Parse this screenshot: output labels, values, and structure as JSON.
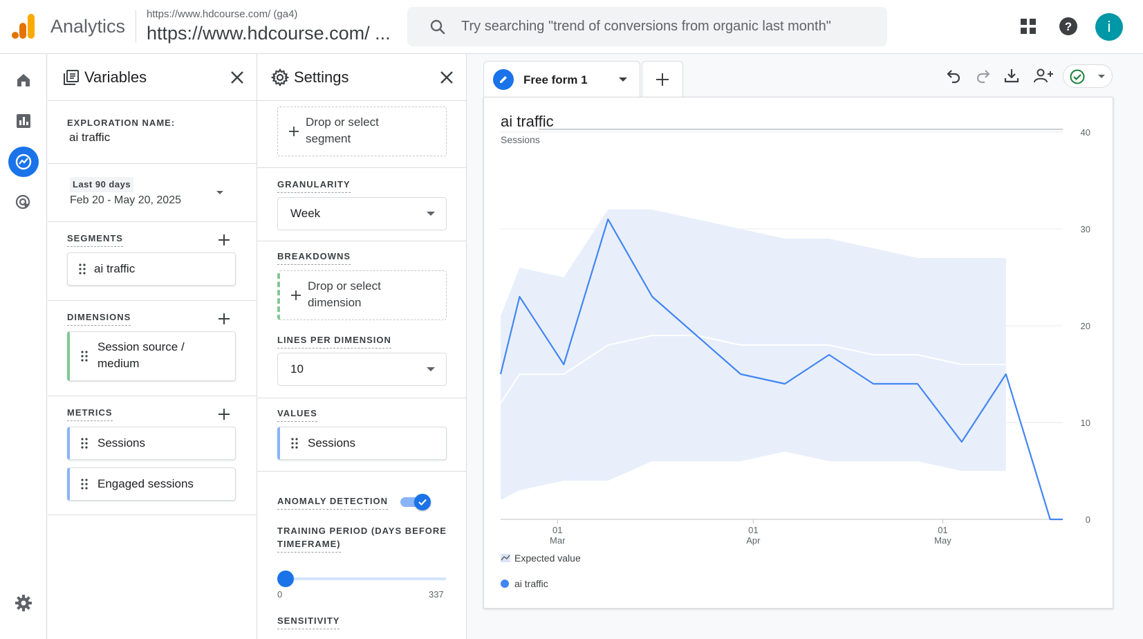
{
  "topbar": {
    "app_name": "Analytics",
    "property_small": "https://www.hdcourse.com/ (ga4)",
    "property_big": "https://www.hdcourse.com/ ...",
    "search_placeholder": "Try searching \"trend of conversions from organic last month\"",
    "avatar_letter": "i",
    "colors": {
      "logo_orange": "#f9ab00",
      "logo_dark": "#e37400",
      "avatar": "#0097a7"
    }
  },
  "variables": {
    "title": "Variables",
    "exploration_label": "EXPLORATION NAME:",
    "exploration_name": "ai traffic",
    "date_badge": "Last 90 days",
    "date_range": "Feb 20 - May 20, 2025",
    "segments_label": "SEGMENTS",
    "segments": [
      "ai traffic"
    ],
    "dimensions_label": "DIMENSIONS",
    "dimensions": [
      "Session source /",
      "medium"
    ],
    "metrics_label": "METRICS",
    "metrics": [
      "Sessions",
      "Engaged sessions"
    ]
  },
  "settings": {
    "title": "Settings",
    "segment_drop": [
      "Drop or select",
      "segment"
    ],
    "granularity_label": "GRANULARITY",
    "granularity_value": "Week",
    "breakdowns_label": "BREAKDOWNS",
    "breakdown_drop": [
      "Drop or select",
      "dimension"
    ],
    "lines_label": "LINES PER DIMENSION",
    "lines_value": "10",
    "values_label": "VALUES",
    "values_item": "Sessions",
    "anomaly_label": "ANOMALY DETECTION",
    "anomaly_enabled": true,
    "training_label_1": "TRAINING PERIOD (DAYS BEFORE",
    "training_label_2": "TIMEFRAME)",
    "training_min": "0",
    "training_max": "337",
    "sensitivity_label": "SENSITIVITY"
  },
  "main": {
    "tab_label": "Free form 1",
    "chart_title": "ai traffic",
    "chart_ylabel": "Sessions",
    "legend_expected": "Expected value",
    "legend_series": "ai traffic"
  },
  "chart_data": {
    "type": "line",
    "title": "ai traffic",
    "ylabel": "Sessions",
    "xlabel": "",
    "ylim": [
      0,
      40
    ],
    "yticks": [
      "40",
      "30",
      "20",
      "10",
      "0"
    ],
    "xticks": [
      {
        "day": "01",
        "month": "Mar",
        "x": "2025-03-01"
      },
      {
        "day": "01",
        "month": "Apr",
        "x": "2025-04-01"
      },
      {
        "day": "01",
        "month": "May",
        "x": "2025-05-01"
      }
    ],
    "x": [
      "2025-02-20",
      "2025-02-23",
      "2025-03-02",
      "2025-03-09",
      "2025-03-16",
      "2025-03-23",
      "2025-03-30",
      "2025-04-06",
      "2025-04-13",
      "2025-04-20",
      "2025-04-27",
      "2025-05-04",
      "2025-05-11",
      "2025-05-18",
      "2025-05-20"
    ],
    "series": [
      {
        "name": "ai traffic",
        "color": "#4285f4",
        "values": [
          15,
          23,
          16,
          31,
          23,
          19,
          15,
          14,
          17,
          14,
          14,
          8,
          15,
          0,
          0
        ]
      }
    ],
    "expected": {
      "name": "Expected value",
      "color": "#ffffff",
      "values": [
        12,
        15,
        15,
        18,
        19,
        19,
        18,
        18,
        18,
        17,
        17,
        16,
        16,
        null,
        null
      ],
      "upper": [
        21,
        26,
        25,
        32,
        32,
        31,
        30,
        29,
        29,
        28,
        27,
        27,
        27,
        null,
        null
      ],
      "lower": [
        2,
        3,
        4,
        4,
        6,
        6,
        6,
        7,
        6,
        6,
        6,
        5,
        5,
        null,
        null
      ],
      "band_color": "#e8effb"
    }
  }
}
